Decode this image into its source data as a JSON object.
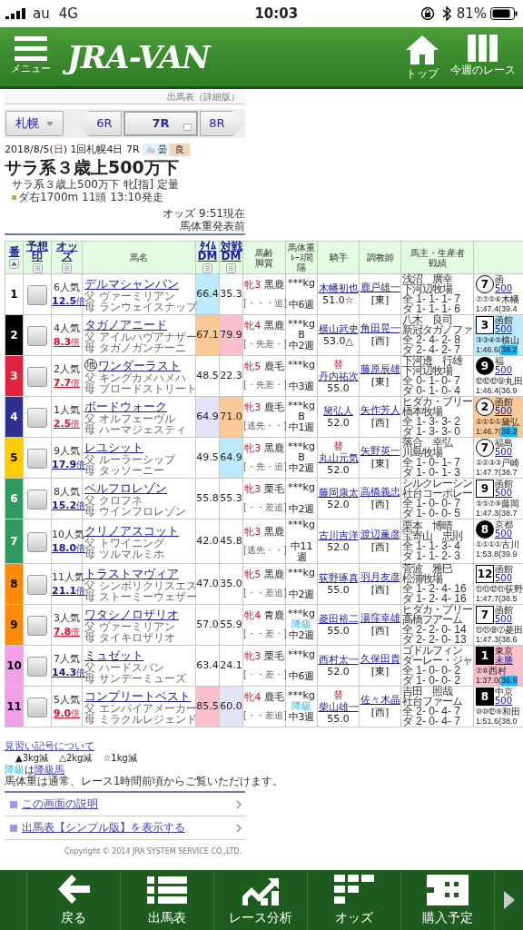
{
  "status_bar": {
    "carrier": "au",
    "network": "4G",
    "time": "10:03",
    "battery": "81%"
  },
  "header": {
    "menu_label": "メニュー",
    "logo": "JRA-VAN",
    "nav": [
      {
        "label": "トップ",
        "kind": "home"
      },
      {
        "label": "今週のレース",
        "kind": "columns"
      }
    ]
  },
  "page_label": "出馬表（詳細版）",
  "race_nav": {
    "venue": "札幌",
    "races": [
      {
        "label": "6R",
        "kind": "prev",
        "selected": false
      },
      {
        "label": "7R",
        "kind": "current",
        "selected": true
      },
      {
        "label": "8R",
        "kind": "next",
        "selected": false
      }
    ]
  },
  "race_info": {
    "date": "2018/8/5(",
    "weekday": "日",
    "meeting": ") 1回札幌4日 7R",
    "weather": "曇",
    "track_condition": "良",
    "title": "サラ系３歳上500万下",
    "conditions": "サラ系３歳上500万下 牝[指] 定量",
    "course": "ダ右1700m 11頭 13:10発走"
  },
  "odds_note": [
    "オッズ 9:51現在",
    "馬体重発表前"
  ],
  "columns": [
    {
      "lines": [
        "番"
      ],
      "kind": "sort_asc"
    },
    {
      "lines": [
        "予想",
        "印"
      ],
      "kind": "sortable"
    },
    {
      "lines": [
        "オッズ"
      ],
      "kind": "sortable"
    },
    {
      "lines": [
        "馬名"
      ],
      "kind": "plain"
    },
    {
      "lines": [
        "ﾀｲﾑ",
        "DM"
      ],
      "kind": "sortable"
    },
    {
      "lines": [
        "対戦",
        "DM"
      ],
      "kind": "sortable"
    },
    {
      "lines": [
        "馬齢",
        "脚質"
      ],
      "kind": "plain"
    },
    {
      "lines": [
        "馬体重",
        "ﾚｰｽ間隔"
      ],
      "kind": "plain"
    },
    {
      "lines": [
        "騎手"
      ],
      "kind": "plain"
    },
    {
      "lines": [
        "調教師"
      ],
      "kind": "plain"
    },
    {
      "lines": [
        "馬主・生産者",
        "戦績"
      ],
      "kind": "plain"
    }
  ],
  "rows": [
    {
      "number": "1",
      "color": "#ffffff",
      "popularity": "6人気",
      "odds": "12.5",
      "odds_unit": "倍",
      "hot": false,
      "name": "デルマシャンパン",
      "sire": "父 ヴァーミリアン",
      "dam": "母 ランウェイスナップ",
      "time_dm": {
        "value": "66.4",
        "color": "#bdeafa"
      },
      "match_dm": {
        "value": "35.3"
      },
      "sex_age": "牝3",
      "coat": "黒鹿",
      "style": "[・・・追]",
      "weight": "***kg",
      "interval": "中6週",
      "jockey": "木幡初也",
      "burden": "51.0☆",
      "trainer": "鹿戸雄一",
      "affiliation": "[東]",
      "owner": "浅沼　廣幸",
      "breeder": "下河辺牧場",
      "record_all": "全 1- 1- 1- 7",
      "record_dirt": "ダ 1- 1- 1- 6",
      "last": {
        "finish": "7",
        "kind": "circle",
        "venue": "函",
        "race": "500",
        "passing": "⑦⑦⑤⑥",
        "jockey": "木幡",
        "time": "1:47.4(",
        "last3f": "39.4",
        "fast": false
      }
    },
    {
      "number": "2",
      "color": "#000000",
      "popularity": "4人気",
      "odds": "8.3",
      "odds_unit": "倍",
      "hot": true,
      "name": "タガノアニード",
      "sire": "父 アイルハヴアナザー",
      "dam": "母 タガノガンチーニ",
      "time_dm": {
        "value": "67.1",
        "color": "#fbc995"
      },
      "match_dm": {
        "value": "79.9",
        "color": "#f9c0cc"
      },
      "sex_age": "牝4",
      "coat": "黒鹿",
      "style": "[・先差・]",
      "weight": "***kg",
      "blinker": "B",
      "interval": "中2週",
      "jockey": "横山武史",
      "burden": "53.0△",
      "trainer": "角田晃一",
      "affiliation": "[西]",
      "owner": "八木　良司",
      "breeder": "新冠タガノファ",
      "record_all": "全 2- 4- 2- 8",
      "record_dirt": "ダ 2- 4- 2- 7",
      "last": {
        "finish": "3",
        "kind": "square",
        "color": "#bdeafa",
        "venue": "函館",
        "race": "500",
        "passing": "③③④⑤",
        "jockey": "横山",
        "time": "1:46.6(",
        "last3f": "38.2",
        "fast": true
      }
    },
    {
      "number": "3",
      "color": "#e0223c",
      "popularity": "2人気",
      "odds": "7.7",
      "odds_unit": "倍",
      "hot": true,
      "marker": "地",
      "name": "ワンダーラスト",
      "sire": "父 キングカメハメハ",
      "dam": "母 ブロードストリート",
      "time_dm": {
        "value": "48.5"
      },
      "match_dm": {
        "value": "22.3"
      },
      "sex_age": "牝5",
      "coat": "鹿毛",
      "style": "[・先差・]",
      "weight": "***kg",
      "interval": "中3週",
      "jockey_change": "替",
      "jockey": "丹内祐次",
      "burden": "55.0",
      "trainer": "藤原辰雄",
      "affiliation": "[東]",
      "owner": "下河邊　行雄",
      "breeder": "下河辺牧場",
      "record_all": "全 0- 1- 0- 7",
      "record_dirt": "ダ 0- 1- 0- 4",
      "last": {
        "finish": "9",
        "kind": "filled_circle",
        "venue": "福",
        "race": "500",
        "passing": "⑫⑫⑫⑨",
        "jockey": "丸田",
        "time": "1:46.4(",
        "last3f": "36.9",
        "fast": false
      }
    },
    {
      "number": "4",
      "color": "#2e3192",
      "popularity": "1人気",
      "odds": "2.5",
      "odds_unit": "倍",
      "hot": true,
      "name": "ボードウォーク",
      "sire": "父 オルフェーヴル",
      "dam": "母 ハーマジェスティ",
      "time_dm": {
        "value": "64.9",
        "color": "#e4e4f8"
      },
      "match_dm": {
        "value": "71.0",
        "color": "#fbc995"
      },
      "sex_age": "牝3",
      "coat": "鹿毛",
      "style": "[逃先・・]",
      "weight": "***kg",
      "blinker": "B",
      "interval": "中1週",
      "jockey": "黛弘人",
      "burden": "52.0",
      "trainer": "矢作芳人",
      "affiliation": "[西]",
      "owner": "ヒダカ・ブリー",
      "breeder": "橋本牧場",
      "record_all": "全 1- 3- 3- 2",
      "record_dirt": "ダ 1- 3- 3- 0",
      "last": {
        "finish": "2",
        "kind": "circle",
        "color": "#fbc995",
        "venue": "函館",
        "race": "500",
        "passing": "①①①①",
        "jockey": "黛弘",
        "time": "1:46.7(",
        "last3f": "38.2",
        "fast": true
      }
    },
    {
      "number": "5",
      "color": "#ffcc00",
      "popularity": "9人気",
      "odds": "17.9",
      "odds_unit": "倍",
      "hot": false,
      "name": "レユシット",
      "sire": "父 ルーラーシップ",
      "dam": "母 タッソーニー",
      "time_dm": {
        "value": "49.5"
      },
      "match_dm": {
        "value": "64.9",
        "color": "#bdeafa"
      },
      "sex_age": "牝3",
      "coat": "黒鹿",
      "style": "[・先・追]",
      "weight": "***kg",
      "blinker": "B",
      "interval": "中2週",
      "jockey_change": "替",
      "jockey": "丸山元気",
      "burden": "52.0",
      "trainer": "矢野英一",
      "affiliation": "[東]",
      "owner": "落合　幸弘",
      "breeder": "川島牧場",
      "record_all": "全 1- 0- 1- 7",
      "record_dirt": "ダ 1- 0- 1- 3",
      "last": {
        "finish": "7",
        "kind": "circle",
        "venue": "福島",
        "race": "500",
        "passing": "②②③③",
        "jockey": "戸崎",
        "time": "1:47.7(",
        "last3f": "38.7",
        "fast": false
      }
    },
    {
      "number": "6",
      "color": "#2e9a5e",
      "popularity": "8人気",
      "odds": "15.2",
      "odds_unit": "倍",
      "hot": false,
      "name": "ベルフロレゾン",
      "sire": "父 クロフネ",
      "dam": "母 ウインフロレゾン",
      "time_dm": {
        "value": "55.8"
      },
      "match_dm": {
        "value": "55.3"
      },
      "sex_age": "牝3",
      "coat": "栗毛",
      "style": "[・・差追]",
      "weight": "***kg",
      "interval": "中2週",
      "jockey": "藤岡康太",
      "burden": "52.0",
      "trainer": "高橋義忠",
      "affiliation": "[西]",
      "owner": "シルクレーシン",
      "breeder": "社台コーポレー",
      "record_all": "全 1- 0- 0- 7",
      "record_dirt": "ダ 1- 0- 0- 5",
      "last": {
        "finish": "9",
        "kind": "square",
        "venue": "函館",
        "race": "500",
        "passing": "⑤⑤⑦⑨",
        "jockey": "藤岡",
        "time": "1:47.3(",
        "last3f": "38.7",
        "fast": false
      }
    },
    {
      "number": "7",
      "color": "#2e9a5e",
      "popularity": "10人気",
      "odds": "18.0",
      "odds_unit": "倍",
      "hot": false,
      "name": "クリノアスコット",
      "sire": "父 トワイニング",
      "dam": "母 ツルマルミホ",
      "time_dm": {
        "value": "42.0"
      },
      "match_dm": {
        "value": "45.8"
      },
      "sex_age": "牝3",
      "coat": "黒鹿",
      "style": "[逃先・・]",
      "weight": "***kg",
      "interval": "中11週",
      "jockey": "古川吉洋",
      "burden": "52.0",
      "trainer": "渡辺薫彦",
      "affiliation": "[西]",
      "owner": "栗本　博晴",
      "breeder": "宝寄山　忠則",
      "record_all": "全 1- 1- 3- 4",
      "record_dirt": "ダ 1- 1- 2- 3",
      "last": {
        "finish": "8",
        "kind": "filled_circle",
        "venue": "京都",
        "race": "500",
        "passing": "①①①①",
        "jockey": "古川",
        "time": "1:53.8(",
        "last3f": "39.9",
        "fast": false
      }
    },
    {
      "number": "8",
      "color": "#ff8c00",
      "popularity": "11人気",
      "odds": "21.1",
      "odds_unit": "倍",
      "hot": false,
      "name": "トラストマヴィア",
      "sire": "父 シンボリクリスエス",
      "dam": "母 ストーミーウェザー",
      "time_dm": {
        "value": "47.0"
      },
      "match_dm": {
        "value": "35.0"
      },
      "sex_age": "牝5",
      "coat": "黒鹿",
      "style": "[・・差追]",
      "weight": "***kg",
      "interval": "中2週",
      "jockey": "荻野琢真",
      "burden": "55.0",
      "trainer": "羽月友彦",
      "affiliation": "[西]",
      "owner": "菅波　雅巳",
      "breeder": "松浦牧場",
      "record_all": "全 1- 2- 4- 16",
      "record_dirt": "ダ 1- 2- 4- 16",
      "last": {
        "finish": "12",
        "kind": "square",
        "venue": "函館",
        "race": "500",
        "passing": "⑪⑪⑫⑪",
        "jockey": "荻野",
        "time": "1:47.7(",
        "last3f": "38.5",
        "fast": false
      }
    },
    {
      "number": "9",
      "color": "#ff8c00",
      "popularity": "3人気",
      "odds": "7.8",
      "odds_unit": "倍",
      "hot": true,
      "name": "ワタシノロザリオ",
      "sire": "父 ヴァーミリアン",
      "dam": "母 タイキロザリオ",
      "time_dm": {
        "value": "57.0"
      },
      "match_dm": {
        "value": "55.9"
      },
      "sex_age": "牝4",
      "coat": "青鹿",
      "style": "[・・差・]",
      "weight": "***kg",
      "demoted": "降級",
      "interval": "中2週",
      "jockey": "菱田裕二",
      "burden": "55.0",
      "trainer": "湯窪幸雄",
      "affiliation": "[西]",
      "owner": "ヒダカ・ブリー",
      "breeder": "高橋フアーム",
      "record_all": "全 2- 2- 0- 14",
      "record_dirt": "ダ 2- 2- 0- 13",
      "last": {
        "finish": "7",
        "kind": "square",
        "venue": "函館",
        "race": "500",
        "passing": "⑪⑪⑧⑦",
        "jockey": "菱田",
        "time": "1:47.3(",
        "last3f": "38.6",
        "fast": false
      }
    },
    {
      "number": "10",
      "color": "#f0a0e8",
      "popularity": "7人気",
      "odds": "14.3",
      "odds_unit": "倍",
      "hot": false,
      "name": "ミュゼット",
      "sire": "父 ハードスパン",
      "dam": "母 サンデーミューズ",
      "time_dm": {
        "value": "63.4"
      },
      "match_dm": {
        "value": "24.1"
      },
      "sex_age": "牝3",
      "coat": "栗毛",
      "style": "[・・差・]",
      "weight": "***kg",
      "interval": "中6週",
      "jockey": "西村太一",
      "burden": "52.0",
      "trainer": "久保田貴",
      "affiliation": "[東]",
      "owner": "ゴドルフィン",
      "breeder": "ダーレー・ジャ",
      "record_all": "全 1- 0- 0- 2",
      "record_dirt": "ダ 1- 0- 0- 2",
      "last": {
        "finish": "1",
        "kind": "filled_square",
        "color": "#f9c0cc",
        "venue": "東京",
        "race": "未勝",
        "passing": "⑦⑥",
        "jockey": "西村",
        "time": "1:37.0(",
        "last3f": "36.9",
        "fast": true
      }
    },
    {
      "number": "11",
      "color": "#f0a0e8",
      "popularity": "5人気",
      "odds": "9.0",
      "odds_unit": "倍",
      "hot": true,
      "name": "コンプリートベスト",
      "sire": "父 エンパイアメーカー",
      "dam": "母 ミラクルレジェンド",
      "time_dm": {
        "value": "85.5",
        "color": "#f9c0cc"
      },
      "match_dm": {
        "value": "60.0",
        "color": "#e4e4f8"
      },
      "sex_age": "牝4",
      "coat": "鹿毛",
      "style": "[・・差追]",
      "weight": "***kg",
      "demoted": "降級",
      "interval": "中3週",
      "jockey_change": "替",
      "jockey": "柴山雄一",
      "burden": "55.0",
      "trainer": "佐々木晶",
      "affiliation": "[西]",
      "owner": "吉田　照哉",
      "breeder": "社台ファーム",
      "record_all": "全 2- 0- 4- 7",
      "record_dirt": "ダ 2- 0- 4- 7",
      "last": {
        "finish": "8",
        "kind": "filled_square",
        "venue": "中京",
        "race": "500",
        "passing": "⑩⑩⑫⑨",
        "jockey": "和田",
        "time": "1:51.6(",
        "last3f": "38.0",
        "fast": false
      }
    }
  ],
  "notes": {
    "apprentice_link": "見習い記号について",
    "apprentice_marks": [
      "▲3kg減",
      "△2kg減",
      "☆1kg減"
    ],
    "demoted_tag": "降級",
    "demoted_text": "は",
    "demoted_link": "降級馬",
    "weight_note": "馬体重は通常、レース1時間前頃からご覧いただけます。"
  },
  "links": [
    "この画面の説明",
    "出馬表【シンプル版】を表示する"
  ],
  "copyright": "Copyright © 2014 JRA SYSTEM SERVICE CO.,LTD.",
  "bottom_nav": [
    {
      "label": "戻る",
      "kind": "back"
    },
    {
      "label": "出馬表",
      "kind": "list"
    },
    {
      "label": "レース分析",
      "kind": "chart"
    },
    {
      "label": "オッズ",
      "kind": "odds"
    },
    {
      "label": "購入予定",
      "kind": "purchase"
    }
  ]
}
